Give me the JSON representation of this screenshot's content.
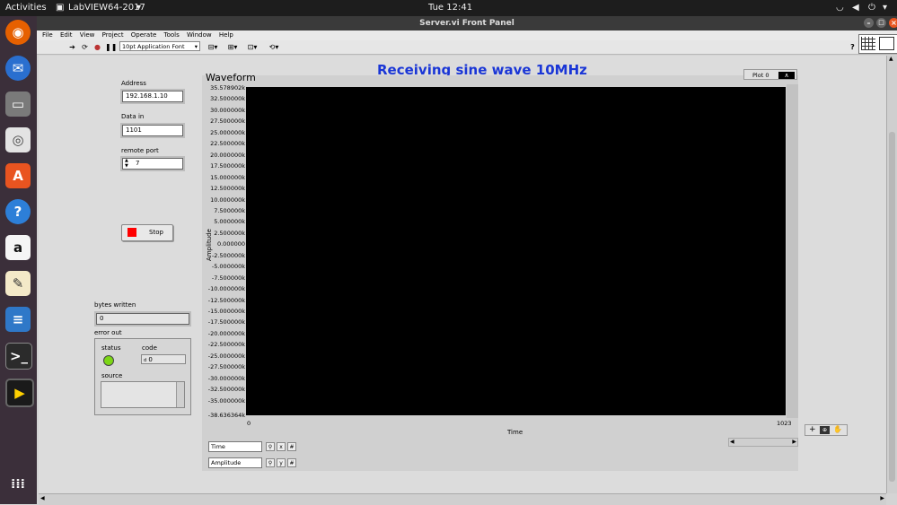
{
  "topbar": {
    "activities": "Activities",
    "app": "LabVIEW64-2017",
    "clock": "Tue 12:41"
  },
  "window": {
    "title": "Server.vi Front Panel"
  },
  "menu": [
    "File",
    "Edit",
    "View",
    "Project",
    "Operate",
    "Tools",
    "Window",
    "Help"
  ],
  "toolbar": {
    "font": "10pt Application Font"
  },
  "panel": {
    "heading": "Receiving sine wave 10MHz ",
    "address": {
      "label": "Address",
      "value": "192.168.1.10"
    },
    "data_in": {
      "label": "Data in",
      "value": "1101"
    },
    "remote_port": {
      "label": "remote port",
      "value": "7"
    },
    "stop_label": "Stop",
    "bytes_written": {
      "label": "bytes written",
      "value": "0"
    },
    "error_out": {
      "label": "error out",
      "status": "status",
      "code": "code",
      "code_value": "0",
      "code_prefix": "d",
      "source": "source"
    }
  },
  "graph": {
    "title": "Waveform",
    "plot_legend": "Plot 0",
    "ylabel": "Amplitude",
    "xlabel": "Time",
    "x_min": "0",
    "x_max": "1023",
    "yticks": [
      "35.578902k",
      "32.500000k",
      "30.000000k",
      "27.500000k",
      "25.000000k",
      "22.500000k",
      "20.000000k",
      "17.500000k",
      "15.000000k",
      "12.500000k",
      "10.000000k",
      "7.500000k",
      "5.000000k",
      "2.500000k",
      "0.000000",
      "-2.500000k",
      "-5.000000k",
      "-7.500000k",
      "-10.000000k",
      "-12.500000k",
      "-15.000000k",
      "-17.500000k",
      "-20.000000k",
      "-22.500000k",
      "-25.000000k",
      "-27.500000k",
      "-30.000000k",
      "-32.500000k",
      "-35.000000k",
      "-38.636364k"
    ],
    "scale_legend": {
      "x_name": "Time",
      "y_name": "Amplitude"
    }
  },
  "colors": {
    "plot_bg": "#000000",
    "heading": "#1a36d6",
    "stop_led": "#ff0000",
    "status_led": "#7cd616"
  }
}
